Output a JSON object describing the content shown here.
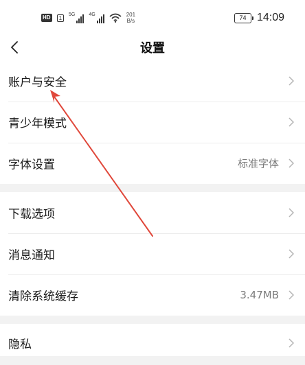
{
  "status_bar": {
    "hd_badge": "HD",
    "sim_label": "1",
    "network_1": "5G",
    "network_2": "4G",
    "speed_value": "201",
    "speed_unit": "B/s",
    "battery_level": "74",
    "time": "14:09",
    "icons": [
      "hd-voice-icon",
      "signal-icon",
      "wifi-icon",
      "battery-icon"
    ]
  },
  "header": {
    "back_icon": "chevron-left-icon",
    "title": "设置"
  },
  "settings": {
    "items": [
      {
        "label": "账户与安全",
        "value": ""
      },
      {
        "label": "青少年模式",
        "value": ""
      },
      {
        "label": "字体设置",
        "value": "标准字体"
      },
      {
        "label": "下载选项",
        "value": ""
      },
      {
        "label": "消息通知",
        "value": ""
      },
      {
        "label": "清除系统缓存",
        "value": "3.47MB"
      },
      {
        "label": "隐私",
        "value": ""
      }
    ]
  },
  "colors": {
    "background": "#f2f2f2",
    "surface": "#ffffff",
    "annotation_arrow": "#e0483b",
    "chevron": "#b5b5b5"
  }
}
